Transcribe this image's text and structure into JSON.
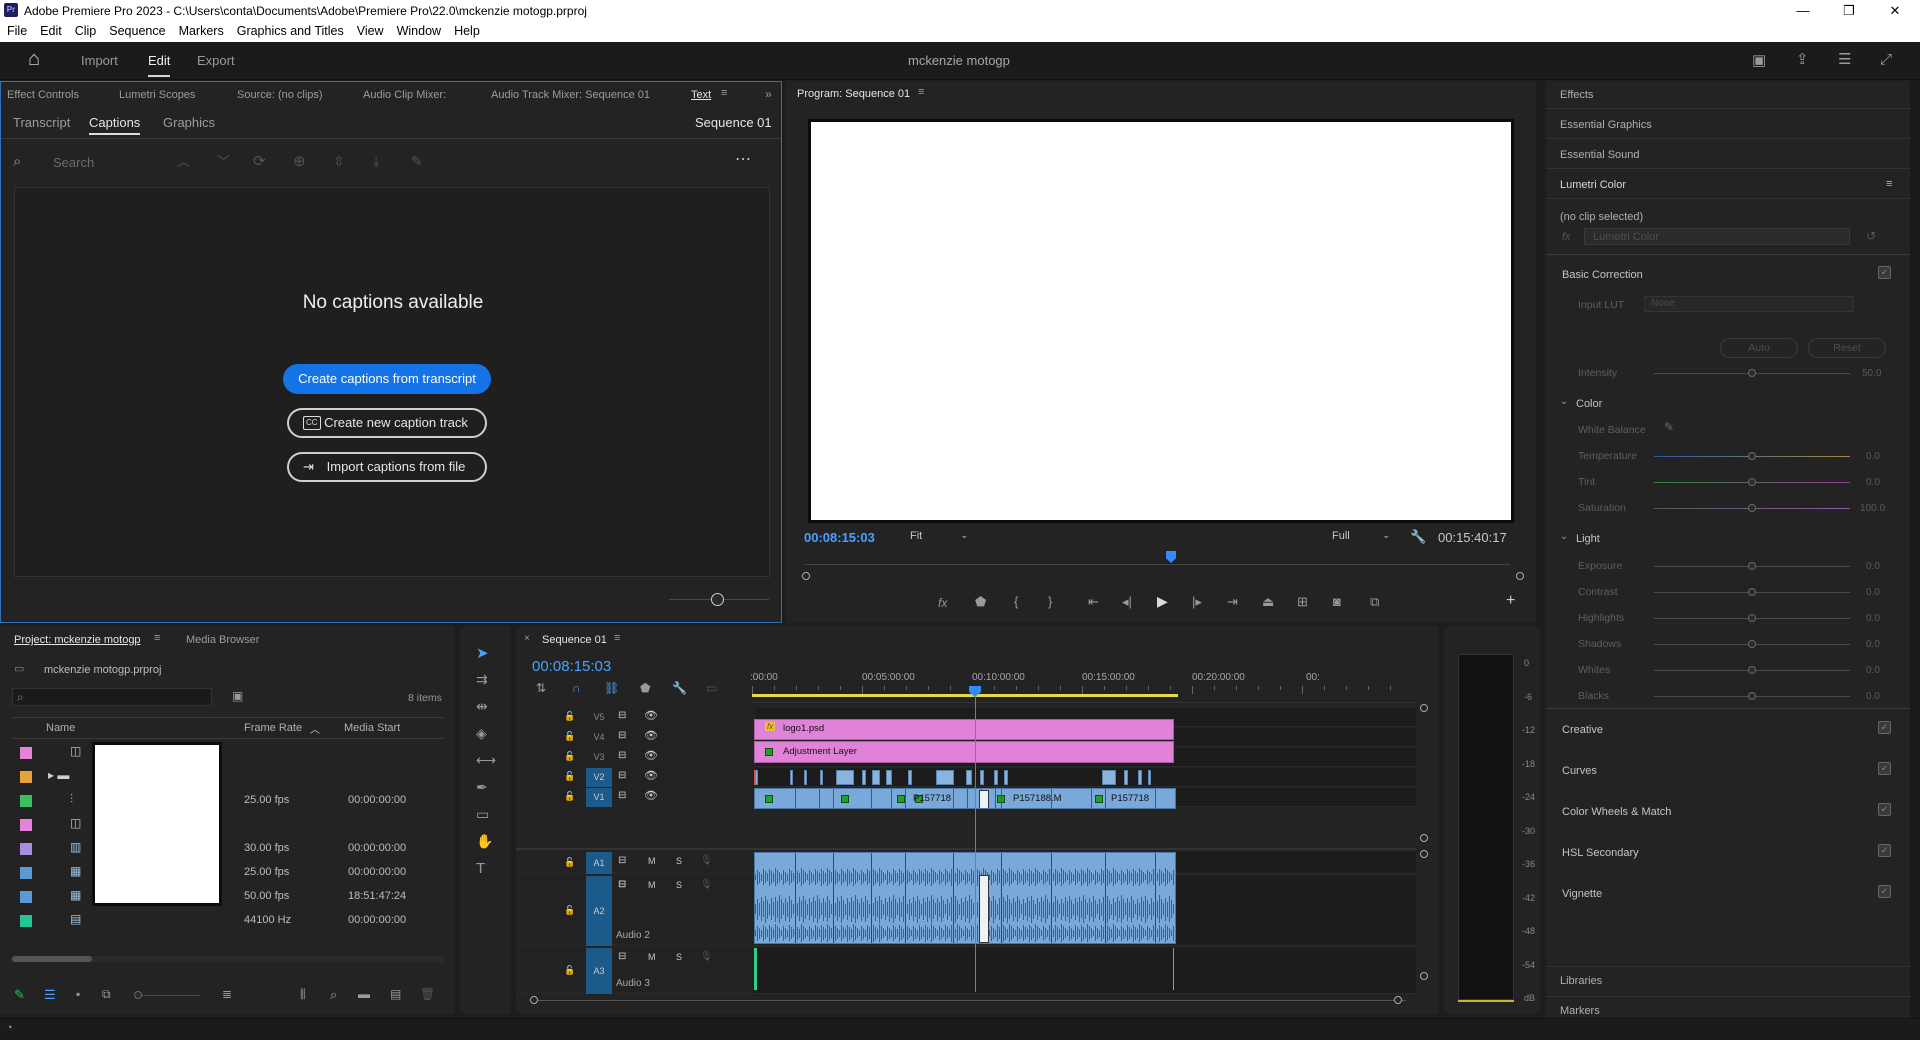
{
  "window": {
    "title": "Adobe Premiere Pro 2023 - C:\\Users\\conta\\Documents\\Adobe\\Premiere Pro\\22.0\\mckenzie motogp.prproj",
    "minimize": "—",
    "maximize": "❐",
    "close": "✕"
  },
  "menu": [
    "File",
    "Edit",
    "Clip",
    "Sequence",
    "Markers",
    "Graphics and Titles",
    "View",
    "Window",
    "Help"
  ],
  "appbar": {
    "home": "⌂",
    "import": "Import",
    "edit": "Edit",
    "export": "Export",
    "project_title": "mckenzie motogp"
  },
  "source_panel": {
    "tabs": [
      "Effect Controls",
      "Lumetri Scopes",
      "Source: (no clips)",
      "Audio Clip Mixer:",
      "Audio Track Mixer: Sequence 01",
      "Text"
    ],
    "subtabs": [
      "Transcript",
      "Captions",
      "Graphics"
    ],
    "sequence_label": "Sequence 01",
    "search_placeholder": "Search",
    "empty_title": "No captions available",
    "btn_create_from_transcript": "Create captions from transcript",
    "btn_new_track": "Create new caption track",
    "btn_import": "Import captions from file",
    "cc_badge": "CC"
  },
  "program": {
    "tab": "Program: Sequence 01",
    "timecode_left": "00:08:15:03",
    "fit": "Fit",
    "full": "Full",
    "timecode_right": "00:15:40:17",
    "playhead_fraction": 0.52
  },
  "lumetri": {
    "panels": [
      "Effects",
      "Essential Graphics",
      "Essential Sound",
      "Lumetri Color"
    ],
    "no_clip": "(no clip selected)",
    "fx": "fx",
    "effect_name": "Lumetri Color",
    "basic_correction": "Basic Correction",
    "input_lut_label": "Input LUT",
    "input_lut_value": "None",
    "auto": "Auto",
    "reset": "Reset",
    "intensity": {
      "label": "Intensity",
      "value": "50.0",
      "level": 0.5
    },
    "color_section": "Color",
    "white_balance": "White Balance",
    "color_sliders": [
      {
        "label": "Temperature",
        "value": "0.0",
        "level": 0.5
      },
      {
        "label": "Tint",
        "value": "0.0",
        "level": 0.5
      },
      {
        "label": "Saturation",
        "value": "100.0",
        "level": 0.5
      }
    ],
    "light_section": "Light",
    "light_sliders": [
      {
        "label": "Exposure",
        "value": "0.0",
        "level": 0.5
      },
      {
        "label": "Contrast",
        "value": "0.0",
        "level": 0.5
      },
      {
        "label": "Highlights",
        "value": "0.0",
        "level": 0.5
      },
      {
        "label": "Shadows",
        "value": "0.0",
        "level": 0.5
      },
      {
        "label": "Whites",
        "value": "0.0",
        "level": 0.5
      },
      {
        "label": "Blacks",
        "value": "0.0",
        "level": 0.5
      }
    ],
    "sections": [
      "Creative",
      "Curves",
      "Color Wheels & Match",
      "HSL Secondary",
      "Vignette"
    ],
    "bottom_panels": [
      "Libraries",
      "Markers"
    ]
  },
  "project": {
    "tabs": [
      "Project: mckenzie motogp",
      "Media Browser"
    ],
    "file": "mckenzie motogp.prproj",
    "items_count": "8 items",
    "columns": [
      "Name",
      "Frame Rate",
      "Media Start"
    ],
    "rows": [
      {
        "color": "#e583d8",
        "fps": "",
        "start": ""
      },
      {
        "color": "#e8a23a",
        "fps": "",
        "start": ""
      },
      {
        "color": "#3bbf5f",
        "fps": "25.00 fps",
        "start": "00:00:00:00"
      },
      {
        "color": "#e583d8",
        "fps": "",
        "start": ""
      },
      {
        "color": "#a98de0",
        "fps": "30.00 fps",
        "start": "00:00:00:00"
      },
      {
        "color": "#5b9bd5",
        "fps": "25.00 fps",
        "start": "00:00:00:00"
      },
      {
        "color": "#5b9bd5",
        "fps": "50.00 fps",
        "start": "18:51:47:24"
      },
      {
        "color": "#27c393",
        "fps": "44100 Hz",
        "start": "00:00:00:00"
      }
    ]
  },
  "timeline": {
    "tab": "Sequence 01",
    "timecode": "00:08:15:03",
    "ruler": [
      ":00:00",
      "00:05:00:00",
      "00:10:00:00",
      "00:15:00:00",
      "00:20:00:00",
      "00:"
    ],
    "video_tracks": [
      "V5",
      "V4",
      "V3",
      "V2",
      "V1"
    ],
    "audio_tracks": [
      "A1",
      "A2",
      "A3"
    ],
    "audio_names": [
      "Audio 2",
      "Audio 3"
    ],
    "clip_logo": "logo1.psd",
    "clip_adjust": "Adjustment Layer",
    "clip_names": [
      "P157718",
      "P157188.M",
      "P157718"
    ],
    "fx_badge": "fx",
    "mute": "M",
    "solo": "S"
  },
  "meter": {
    "ticks": [
      "0",
      "-6",
      "-12",
      "-18",
      "-24",
      "-30",
      "-36",
      "-42",
      "-48",
      "-54",
      "dB"
    ]
  }
}
